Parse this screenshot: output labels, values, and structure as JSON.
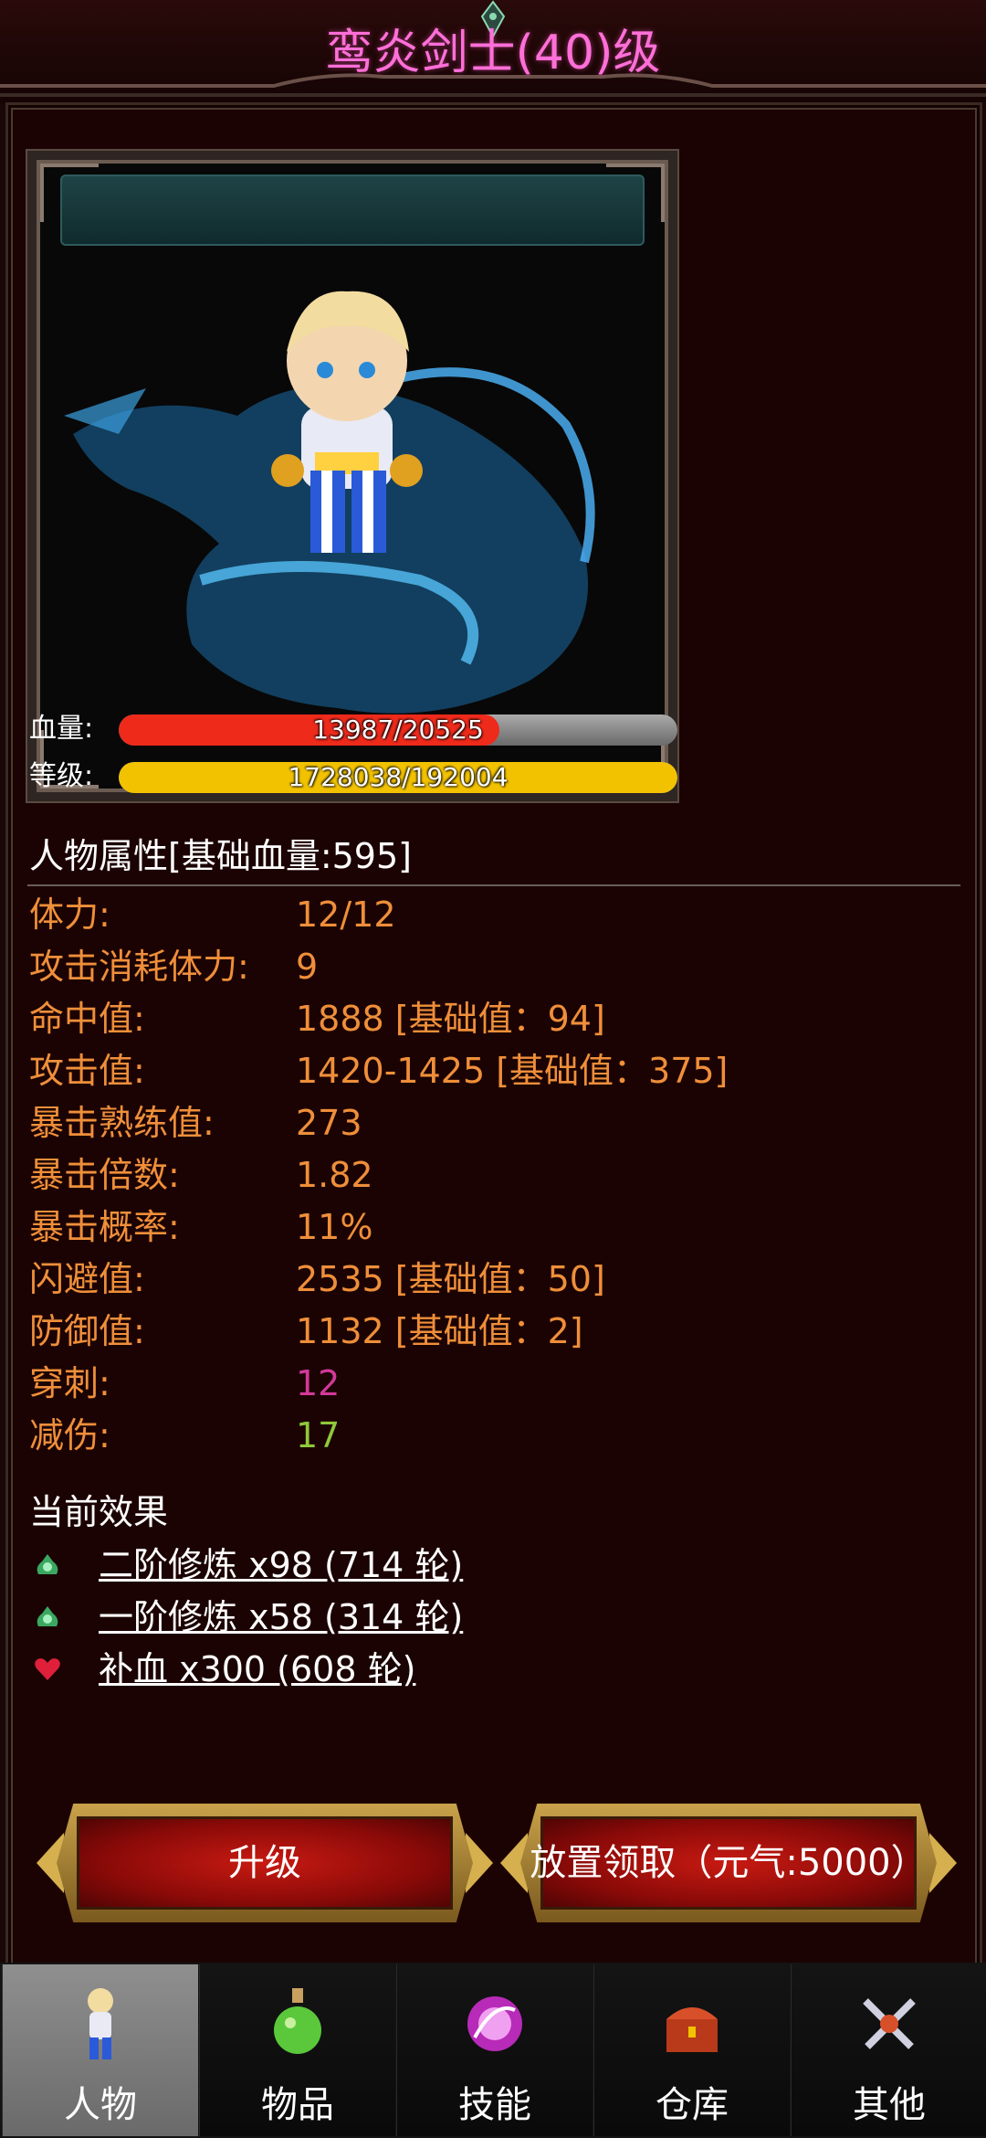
{
  "header": {
    "title": "鸾炎剑士(40)级"
  },
  "bars": {
    "hp": {
      "label": "血量:",
      "text": "13987/20525",
      "current": 13987,
      "max": 20525,
      "color": "#ee2a1b"
    },
    "exp": {
      "label": "等级:",
      "text": "1728038/192004",
      "fill_fraction": 1.0,
      "color": "#f2c200"
    }
  },
  "attributes": {
    "title": "人物属性[基础血量:595]",
    "rows": [
      {
        "label": "体力:",
        "value": "12/12",
        "color": "#ef8f3a"
      },
      {
        "label": "攻击消耗体力:",
        "value": "9",
        "color": "#ef8f3a"
      },
      {
        "label": "命中值:",
        "value": "1888 [基础值：94]",
        "color": "#ef8f3a"
      },
      {
        "label": "攻击值:",
        "value": "1420-1425 [基础值：375]",
        "color": "#ef8f3a"
      },
      {
        "label": "暴击熟练值:",
        "value": "273",
        "color": "#ef8f3a"
      },
      {
        "label": "暴击倍数:",
        "value": "1.82",
        "color": "#ef8f3a"
      },
      {
        "label": "暴击概率:",
        "value": "11%",
        "color": "#ef8f3a"
      },
      {
        "label": "闪避值:",
        "value": "2535 [基础值：50]",
        "color": "#ef8f3a"
      },
      {
        "label": "防御值:",
        "value": "1132 [基础值：2]",
        "color": "#ef8f3a"
      },
      {
        "label": "穿刺:",
        "value": "12",
        "color": "#d2399a"
      },
      {
        "label": "减伤:",
        "value": "17",
        "color": "#8fc83a"
      }
    ]
  },
  "effects": {
    "title": "当前效果",
    "items": [
      {
        "icon": "green-cauldron-icon",
        "text": "二阶修炼 x98 (714 轮)"
      },
      {
        "icon": "green-cauldron-icon",
        "text": "一阶修炼 x58 (314 轮)"
      },
      {
        "icon": "heart-icon",
        "text": "补血 x300 (608 轮)"
      }
    ]
  },
  "actions": {
    "upgrade": "升级",
    "collect": "放置领取（元气:5000）"
  },
  "tabs": [
    {
      "label": "人物",
      "icon": "character-icon",
      "active": true
    },
    {
      "label": "物品",
      "icon": "potion-icon",
      "active": false
    },
    {
      "label": "技能",
      "icon": "skill-orb-icon",
      "active": false
    },
    {
      "label": "仓库",
      "icon": "treasure-chest-icon",
      "active": false
    },
    {
      "label": "其他",
      "icon": "crossed-swords-icon",
      "active": false
    }
  ]
}
